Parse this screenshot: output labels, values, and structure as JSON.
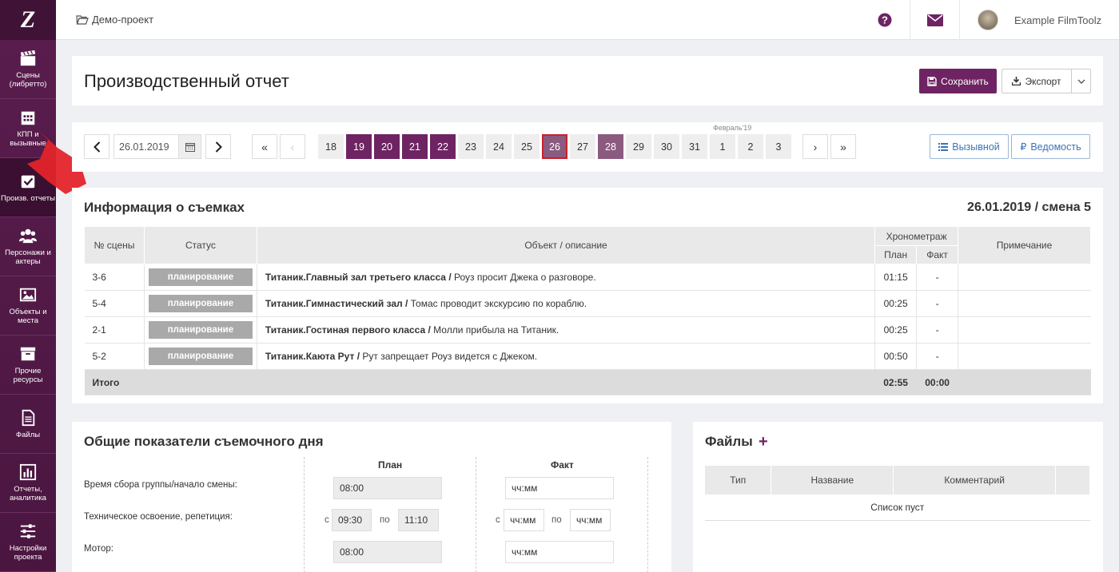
{
  "app": {
    "logo": "Z",
    "project": "Демо-проект",
    "user": "Example FilmToolz"
  },
  "sidebar": {
    "items": [
      {
        "label": "Сцены (либретто)",
        "icon": "clapperboard-icon"
      },
      {
        "label": "КПП и вызывные",
        "icon": "calendar-icon"
      },
      {
        "label": "Произв. отчеты",
        "icon": "check-icon"
      },
      {
        "label": "Персонажи и актеры",
        "icon": "people-icon"
      },
      {
        "label": "Объекты и места",
        "icon": "image-icon"
      },
      {
        "label": "Прочие ресурсы",
        "icon": "archive-icon"
      },
      {
        "label": "Файлы",
        "icon": "file-icon"
      },
      {
        "label": "Отчеты, аналитика",
        "icon": "chart-icon"
      },
      {
        "label": "Настройки проекта",
        "icon": "sliders-icon"
      }
    ]
  },
  "header": {
    "title": "Производственный отчет",
    "save_label": "Сохранить",
    "export_label": "Экспорт"
  },
  "datebar": {
    "date": "26.01.2019",
    "month_label": "Февраль'19",
    "first": "«",
    "prev": "‹",
    "next": "›",
    "last": "»",
    "days": [
      {
        "n": "18",
        "state": "plain"
      },
      {
        "n": "19",
        "state": "filled"
      },
      {
        "n": "20",
        "state": "filled"
      },
      {
        "n": "21",
        "state": "filled"
      },
      {
        "n": "22",
        "state": "filled"
      },
      {
        "n": "23",
        "state": "plain"
      },
      {
        "n": "24",
        "state": "plain"
      },
      {
        "n": "25",
        "state": "plain"
      },
      {
        "n": "26",
        "state": "current"
      },
      {
        "n": "27",
        "state": "plain"
      },
      {
        "n": "28",
        "state": "filled2"
      },
      {
        "n": "29",
        "state": "plain"
      },
      {
        "n": "30",
        "state": "plain"
      },
      {
        "n": "31",
        "state": "plain"
      },
      {
        "n": "1",
        "state": "plain"
      },
      {
        "n": "2",
        "state": "plain"
      },
      {
        "n": "3",
        "state": "plain"
      }
    ],
    "btn_call": "Вызывной",
    "btn_sheet": "Ведомость"
  },
  "info": {
    "title": "Информация о съемках",
    "date_shift": "26.01.2019 / смена 5",
    "columns": {
      "scene": "№ сцены",
      "status": "Статус",
      "object": "Объект / описание",
      "timing": "Хронометраж",
      "plan": "План",
      "fact": "Факт",
      "note": "Примечание"
    },
    "rows": [
      {
        "scene": "3-6",
        "status": "планирование",
        "object": "Титаник.Главный зал третьего класса /",
        "desc": " Роуз просит Джека о разговоре.",
        "plan": "01:15",
        "fact": "-"
      },
      {
        "scene": "5-4",
        "status": "планирование",
        "object": "Титаник.Гимнастический зал /",
        "desc": " Томас проводит экскурсию по кораблю.",
        "plan": "00:25",
        "fact": "-"
      },
      {
        "scene": "2-1",
        "status": "планирование",
        "object": "Титаник.Гостиная первого класса /",
        "desc": " Молли прибыла на Титаник.",
        "plan": "00:25",
        "fact": "-"
      },
      {
        "scene": "5-2",
        "status": "планирование",
        "object": "Титаник.Каюта Рут /",
        "desc": " Рут запрещает Роуз видется с Джеком.",
        "plan": "00:50",
        "fact": "-"
      }
    ],
    "total_label": "Итого",
    "total_plan": "02:55",
    "total_fact": "00:00"
  },
  "metrics": {
    "title": "Общие показатели съемочного дня",
    "plan_header": "План",
    "fact_header": "Факт",
    "row1_label": "Время сбора группы/начало смены:",
    "row1_plan": "08:00",
    "row1_fact_placeholder": "чч:мм",
    "row2_label": "Техническое освоение, репетиция:",
    "from": "с",
    "to": "по",
    "row2_plan_from": "09:30",
    "row2_plan_to": "11:10",
    "row2_fact_from": "чч:мм",
    "row2_fact_to": "чч:мм",
    "row3_label": "Мотор:",
    "row3_plan": "08:00",
    "row3_fact_placeholder": "чч:мм"
  },
  "files": {
    "title": "Файлы",
    "plus": "+",
    "col_type": "Тип",
    "col_name": "Название",
    "col_comment": "Комментарий",
    "empty": "Список пуст"
  },
  "colors": {
    "brand": "#6e2463",
    "sidebar": "#4a1640",
    "day_filled": "#6e2463",
    "day_current_border": "#c8202c",
    "link_blue": "#3a73b5",
    "status_gray": "#a9a9a9"
  }
}
